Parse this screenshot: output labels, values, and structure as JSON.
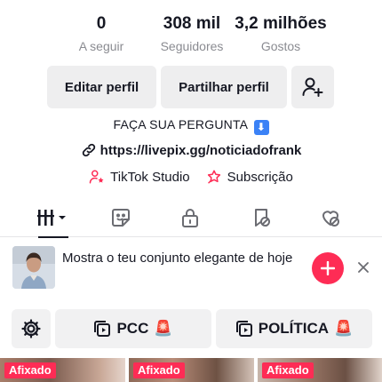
{
  "stats": {
    "following": {
      "value": "0",
      "label": "A seguir"
    },
    "followers": {
      "value": "308 mil",
      "label": "Seguidores"
    },
    "likes": {
      "value": "3,2 milhões",
      "label": "Gostos"
    }
  },
  "actions": {
    "edit_profile": "Editar perfil",
    "share_profile": "Partilhar perfil",
    "add_friend_icon": "person-plus-icon"
  },
  "bio": {
    "text": "FAÇA SUA PERGUNTA",
    "emoji": "⬇"
  },
  "link": {
    "url": "https://livepix.gg/noticiadofrank"
  },
  "tools": {
    "studio": "TikTok Studio",
    "subscription": "Subscrição"
  },
  "tabs": [
    {
      "icon": "grid-icon",
      "active": true
    },
    {
      "icon": "sticker-icon",
      "active": false
    },
    {
      "icon": "lock-icon",
      "active": false
    },
    {
      "icon": "hidden-bookmark-icon",
      "active": false
    },
    {
      "icon": "hidden-heart-icon",
      "active": false
    }
  ],
  "prompt": {
    "text": "Mostra o teu conjunto elegante de hoje"
  },
  "chips": {
    "pcc": "PCC",
    "politica": "POLÍTICA",
    "siren": "🚨"
  },
  "videos": [
    {
      "badge": "Afixado"
    },
    {
      "badge": "Afixado"
    },
    {
      "badge": "Afixado"
    }
  ],
  "colors": {
    "accent": "#fe2c55",
    "text": "#161823",
    "muted": "#8a8b91",
    "button_bg": "#eeeeef"
  }
}
